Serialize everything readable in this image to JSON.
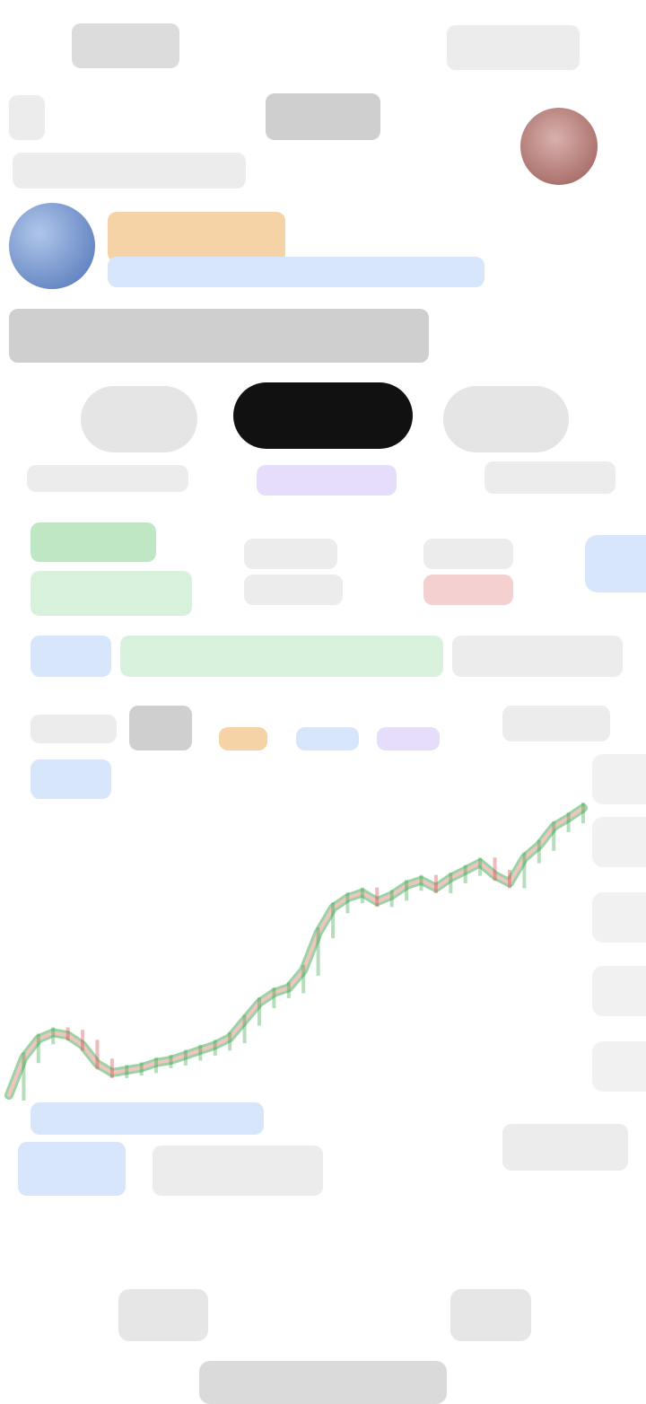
{
  "icons": {
    "avatar": "coin-avatar-icon",
    "profile": "profile-avatar-icon"
  },
  "colors": {
    "up": "#2ea043",
    "down": "#d23a3a",
    "accent": "#3c6fd8",
    "chip_active": "#111111"
  },
  "chart_data": {
    "type": "line",
    "x": [
      0,
      1,
      2,
      3,
      4,
      5,
      6,
      7,
      8,
      9,
      10,
      11,
      12,
      13,
      14,
      15,
      16,
      17,
      18,
      19,
      20,
      21,
      22,
      23,
      24,
      25,
      26,
      27,
      28,
      29,
      30,
      31,
      32,
      33,
      34,
      35,
      36,
      37,
      38,
      39
    ],
    "series": [
      {
        "values": [
          10,
          40,
          55,
          60,
          58,
          50,
          35,
          28,
          30,
          32,
          36,
          38,
          42,
          46,
          50,
          56,
          70,
          84,
          92,
          96,
          110,
          140,
          160,
          168,
          172,
          165,
          170,
          178,
          182,
          176,
          184,
          190,
          196,
          186,
          180,
          200,
          210,
          225,
          232,
          240
        ]
      }
    ]
  }
}
